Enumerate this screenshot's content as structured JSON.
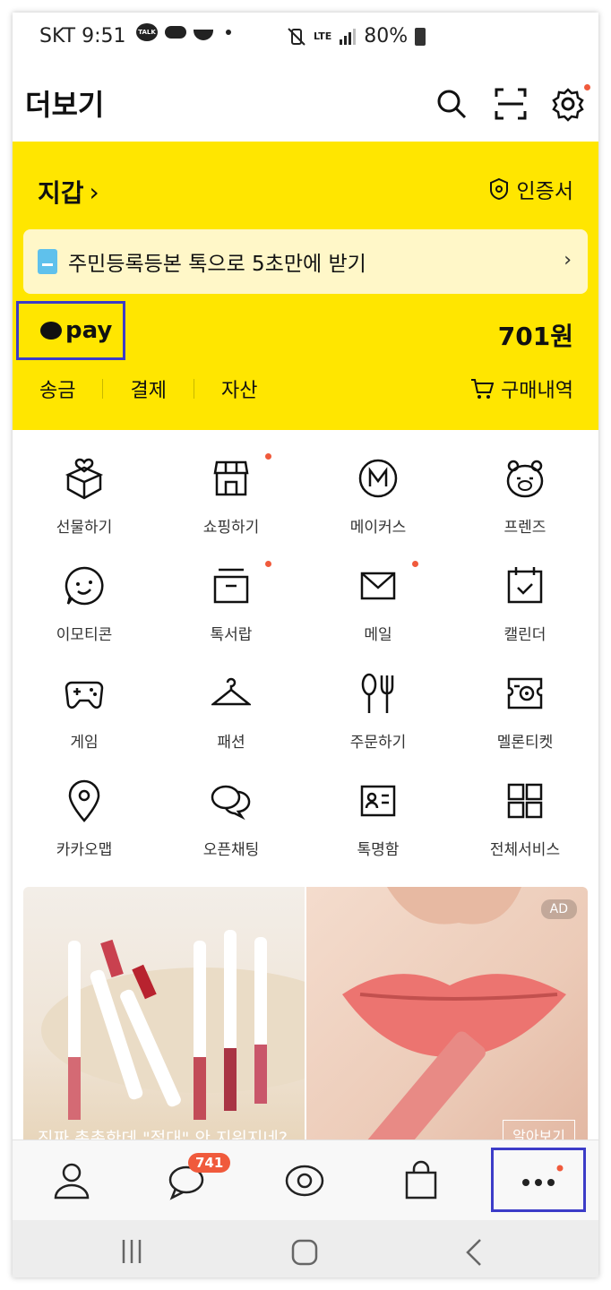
{
  "status_bar": {
    "carrier_time": "SKT 9:51",
    "talk_badge": "TALK",
    "network": "LTE",
    "battery": "80%"
  },
  "header": {
    "title": "더보기"
  },
  "wallet": {
    "title": "지갑",
    "cert_label": "인증서",
    "banner_text": "주민등록등본 톡으로 5초만에 받기",
    "pay_label": "pay",
    "balance": "701원",
    "menu": [
      "송금",
      "결제",
      "자산"
    ],
    "purchase_label": "구매내역"
  },
  "services": [
    {
      "label": "선물하기",
      "icon": "gift-icon"
    },
    {
      "label": "쇼핑하기",
      "icon": "store-icon",
      "new": true
    },
    {
      "label": "메이커스",
      "icon": "makers-icon"
    },
    {
      "label": "프렌즈",
      "icon": "bear-icon"
    },
    {
      "label": "이모티콘",
      "icon": "emoticon-icon"
    },
    {
      "label": "톡서랍",
      "icon": "drawer-icon",
      "new": true
    },
    {
      "label": "메일",
      "icon": "mail-icon",
      "new": true
    },
    {
      "label": "캘린더",
      "icon": "calendar-icon"
    },
    {
      "label": "게임",
      "icon": "gamepad-icon"
    },
    {
      "label": "패션",
      "icon": "hanger-icon"
    },
    {
      "label": "주문하기",
      "icon": "fork-spoon-icon"
    },
    {
      "label": "멜론티켓",
      "icon": "ticket-icon"
    },
    {
      "label": "카카오맵",
      "icon": "map-pin-icon"
    },
    {
      "label": "오픈채팅",
      "icon": "chat-bubbles-icon"
    },
    {
      "label": "톡명함",
      "icon": "namecard-icon"
    },
    {
      "label": "전체서비스",
      "icon": "grid-icon"
    }
  ],
  "ad": {
    "tag": "AD",
    "caption": "진짜 촉촉한데 \"절대\" 안 지워지네?",
    "more_label": "알아보기"
  },
  "tabbar": {
    "chat_badge": "741"
  },
  "colors": {
    "wallet_bg": "#ffe600",
    "accent_red": "#f05a3c",
    "highlight": "#3c3cc8"
  }
}
